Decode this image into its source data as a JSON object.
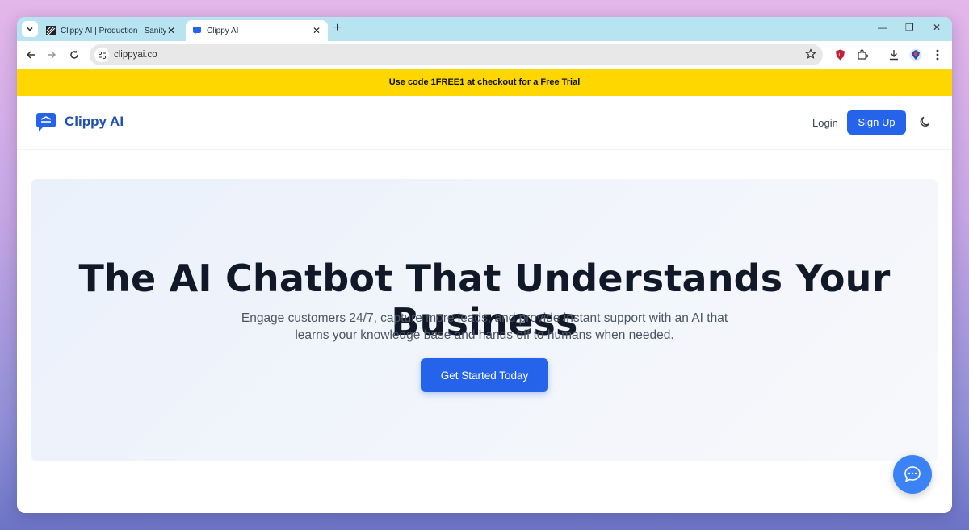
{
  "browser": {
    "tabs": [
      {
        "title": "Clippy AI | Production | Sanity",
        "active": false
      },
      {
        "title": "Clippy AI",
        "active": true
      }
    ],
    "url": "clippyai.co"
  },
  "promo": {
    "text": "Use code 1FREE1 at checkout for a Free Trial",
    "color": "#ffd700"
  },
  "header": {
    "brand": "Clippy AI",
    "login_label": "Login",
    "signup_label": "Sign Up",
    "theme_toggle_icon": "moon-icon"
  },
  "hero": {
    "title": "The AI Chatbot That Understands Your Business",
    "subtitle": "Engage customers 24/7, capture more leads, and provide instant support with an AI that learns your knowledge base and hands off to humans when needed.",
    "cta_label": "Get Started Today"
  },
  "chat_widget": {
    "icon": "chat-bubble-icon"
  },
  "colors": {
    "accent": "#2563eb",
    "brand": "#1f4fb0",
    "tabstrip": "#b8e4f1"
  }
}
